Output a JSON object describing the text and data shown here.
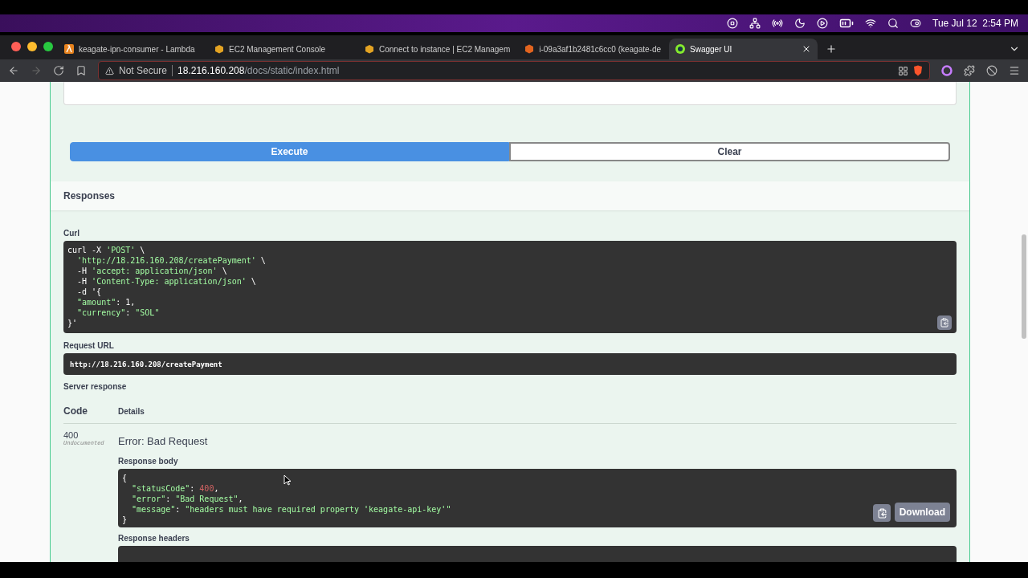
{
  "menubar": {
    "clock": "Tue Jul 12  2:54 PM"
  },
  "tabs": [
    {
      "title": "keagate-ipn-consumer - Lambda",
      "kind": "lambda",
      "selected": false
    },
    {
      "title": "EC2 Management Console",
      "kind": "box",
      "selected": false
    },
    {
      "title": "Connect to instance | EC2 Managem",
      "kind": "box",
      "selected": false
    },
    {
      "title": "i-09a3af1b2481c6cc0 (keagate-de",
      "kind": "hexagon",
      "selected": false
    },
    {
      "title": "Swagger UI",
      "kind": "swagger",
      "selected": true
    }
  ],
  "address_bar": {
    "security": "Not Secure",
    "host": "18.216.160.208",
    "path": "/docs/static/index.html"
  },
  "buttons": [
    {
      "label": "Execute",
      "kind": "primary"
    },
    {
      "label": "Clear",
      "kind": "secondary"
    }
  ],
  "responses": {
    "title": "Responses",
    "curl_label": "Curl",
    "curl": [
      "curl -X 'POST' \\",
      "  'http://18.216.160.208/createPayment' \\",
      "  -H 'accept: application/json' \\",
      "  -H 'Content-Type: application/json' \\",
      "  -d '{",
      "  \"amount\": 1,",
      "  \"currency\": \"SOL\"",
      "}'"
    ],
    "request_url_label": "Request URL",
    "request_url": "http://18.216.160.208/createPayment",
    "server_response_label": "Server response",
    "columns": [
      "Code",
      "Details"
    ],
    "code": "400",
    "code_note": "Undocumented",
    "details_title": "Error: Bad Request",
    "body_label": "Response body",
    "body": [
      "{",
      "  \"statusCode\": 400,",
      "  \"error\": \"Bad Request\",",
      "  \"message\": \"headers must have required property 'keagate-api-key'\"",
      "}"
    ],
    "download": "Download",
    "headers_label": "Response headers"
  }
}
